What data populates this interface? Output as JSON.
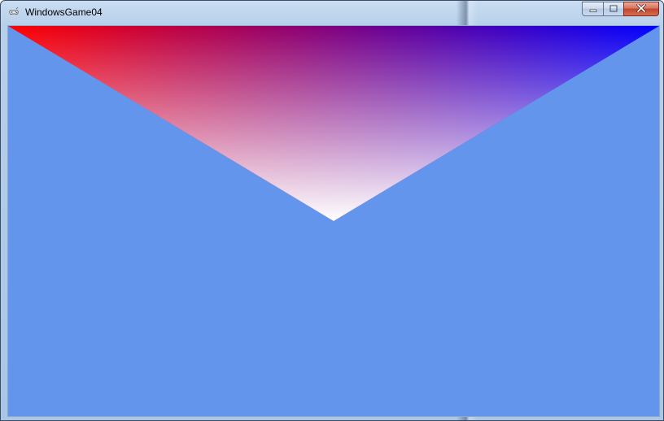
{
  "window": {
    "title": "WindowsGame04",
    "icon": "gamepad-icon",
    "controls": {
      "minimize_icon": "minimize-icon",
      "maximize_icon": "maximize-icon",
      "close_icon": "close-icon"
    }
  },
  "scene": {
    "clear_color": "#6495ED",
    "triangle_vertex_colors": [
      "#FF0000",
      "#0000FF",
      "#FFFFFF"
    ]
  }
}
